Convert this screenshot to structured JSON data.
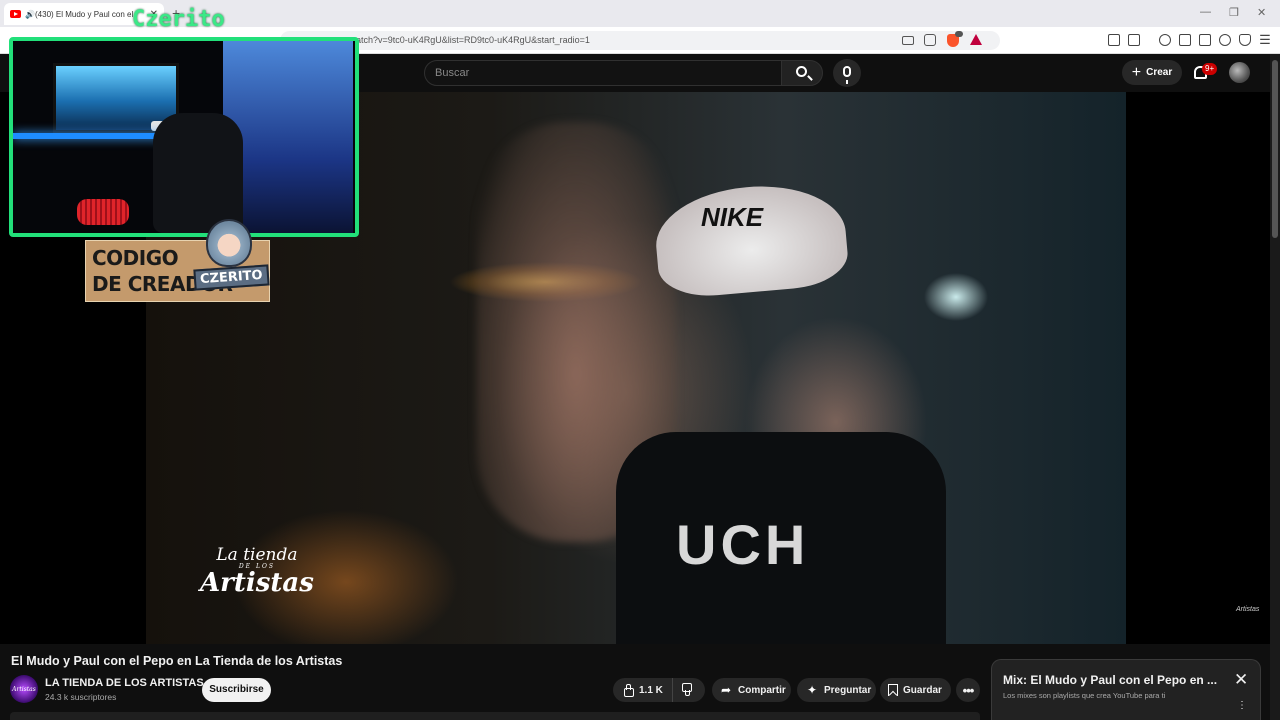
{
  "browser": {
    "tab_title": "(430) El Mudo y Paul con el",
    "tab_close": "✕",
    "new_tab": "+",
    "url": "atch?v=9tc0-uK4RgU&list=RD9tc0-uK4RgU&start_radio=1",
    "window_controls": [
      "—",
      "❐",
      "✕"
    ]
  },
  "youtube": {
    "search_placeholder": "Buscar",
    "create_label": "Crear",
    "notification_count": "9+"
  },
  "overlay": {
    "webcam_label": "Czerito",
    "creator_line1": "CODIGO",
    "creator_line2": "DE CREADOR",
    "creator_badge": "CZERITO"
  },
  "video_frame": {
    "cap_brand": "NIKE",
    "hoodie_text": "UCH",
    "logo_line1": "La tienda",
    "logo_line2": "DE LOS",
    "logo_line3": "Artistas",
    "corner_watermark": "Artistas"
  },
  "video": {
    "title": "El Mudo y Paul con el Pepo en La Tienda de los Artistas",
    "channel_name": "LA TIENDA DE LOS ARTISTAS",
    "channel_avatar_text": "Artistas",
    "subscribers": "24.3 k suscriptores",
    "subscribe_label": "Suscribirse",
    "likes": "1.1 K",
    "share_label": "Compartir",
    "ask_label": "Preguntar",
    "save_label": "Guardar",
    "more_label": "•••"
  },
  "mix_panel": {
    "title": "Mix: El Mudo y Paul con el Pepo en ...",
    "subtitle": "Los mixes son playlists que crea YouTube para ti",
    "close": "✕",
    "more": "⋮"
  },
  "colors": {
    "background": "#0f0f0f",
    "webcam_border": "#22e07a",
    "brand_red": "#ff0000",
    "notification_red": "#cc0000"
  }
}
